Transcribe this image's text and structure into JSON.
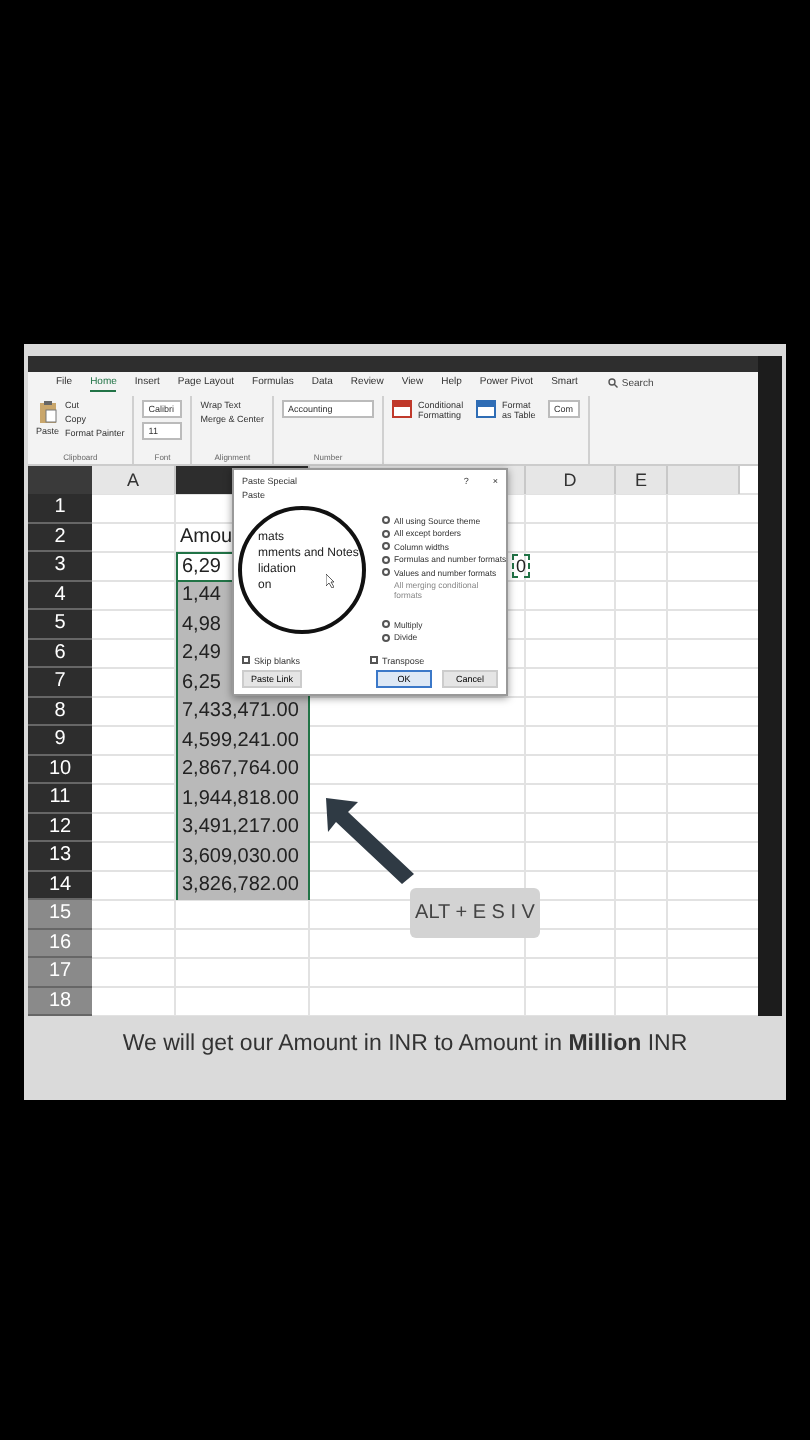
{
  "ribbon": {
    "tabs": [
      {
        "label": "File",
        "selected": false
      },
      {
        "label": "Home",
        "selected": true
      },
      {
        "label": "Insert",
        "selected": false
      },
      {
        "label": "Page Layout",
        "selected": false
      },
      {
        "label": "Formulas",
        "selected": false
      },
      {
        "label": "Data",
        "selected": false
      },
      {
        "label": "Review",
        "selected": false
      },
      {
        "label": "View",
        "selected": false
      },
      {
        "label": "Help",
        "selected": false
      },
      {
        "label": "Power Pivot",
        "selected": false
      },
      {
        "label": "Smart",
        "selected": false
      }
    ],
    "search": "Search",
    "groups": [
      {
        "label": "Clipboard",
        "big": "Paste",
        "items": [
          "Cut",
          "Copy",
          "Format Painter"
        ]
      },
      {
        "label": "Font",
        "items": [
          "Calibri",
          "11"
        ]
      },
      {
        "label": "Alignment",
        "items": [
          "Wrap Text",
          "Merge & Center"
        ]
      },
      {
        "label": "Number",
        "items": [
          "Accounting"
        ]
      },
      {
        "items": [
          "Conditional Formatting",
          "Format as Table",
          "Com"
        ]
      }
    ]
  },
  "sheet": {
    "columns": [
      {
        "label": "A",
        "selected": false
      },
      {
        "selected": true
      },
      {
        "selected": false
      },
      {
        "label": "D",
        "selected": false
      },
      {
        "label": "E",
        "selected": false
      },
      {
        "selected": false
      }
    ],
    "rows": [
      {
        "number": "1",
        "selected": true,
        "kind": "plain"
      },
      {
        "number": "2",
        "selected": true,
        "kind": "plain",
        "value": "Amou"
      },
      {
        "number": "3",
        "selected": true,
        "kind": "active",
        "value": "6,29",
        "copied_value": "0"
      },
      {
        "number": "4",
        "selected": true,
        "kind": "range",
        "value": "1,44"
      },
      {
        "number": "5",
        "selected": true,
        "kind": "range",
        "value": "4,98"
      },
      {
        "number": "6",
        "selected": true,
        "kind": "range",
        "value": "2,49"
      },
      {
        "number": "7",
        "selected": true,
        "kind": "range",
        "value": "6,25"
      },
      {
        "number": "8",
        "selected": true,
        "kind": "range",
        "value": "7,433,471.00"
      },
      {
        "number": "9",
        "selected": true,
        "kind": "range",
        "value": "4,599,241.00"
      },
      {
        "number": "10",
        "selected": true,
        "kind": "range",
        "value": "2,867,764.00"
      },
      {
        "number": "11",
        "selected": true,
        "kind": "range",
        "value": "1,944,818.00"
      },
      {
        "number": "12",
        "selected": true,
        "kind": "range",
        "value": "3,491,217.00"
      },
      {
        "number": "13",
        "selected": true,
        "kind": "range",
        "value": "3,609,030.00"
      },
      {
        "number": "14",
        "selected": true,
        "kind": "range",
        "value": "3,826,782.00"
      },
      {
        "number": "15",
        "selected": false,
        "kind": "plain"
      },
      {
        "number": "16",
        "selected": false,
        "kind": "plain"
      },
      {
        "number": "17",
        "selected": false,
        "kind": "plain"
      },
      {
        "number": "18",
        "selected": false,
        "kind": "plain"
      }
    ]
  },
  "dialog": {
    "title": "Paste Special",
    "help": "?",
    "close": "×",
    "section": "Paste",
    "options": [
      {
        "label": "All using Source theme",
        "selected": false
      },
      {
        "label": "All except borders",
        "selected": false
      },
      {
        "label": "Column widths",
        "selected": false
      },
      {
        "label": "Formulas and number formats",
        "selected": false
      },
      {
        "label": "Values and number formats",
        "selected": false
      }
    ],
    "note": "All merging conditional formats",
    "operations": [
      {
        "label": "Multiply",
        "selected": false
      },
      {
        "label": "Divide",
        "selected": false
      }
    ],
    "checks": [
      {
        "label": "Skip blanks",
        "checked": false
      },
      {
        "label": "Transpose",
        "checked": false
      }
    ],
    "buttons": [
      {
        "label": "Paste Link",
        "default": false
      },
      {
        "label": "OK",
        "default": true
      },
      {
        "label": "Cancel",
        "default": false
      }
    ],
    "magnifier": [
      "mats",
      "mments and Notes",
      "lidation",
      "on"
    ]
  },
  "shortcut": "ALT + E S I V",
  "caption": "We will get our Amount in INR to Amount in **Million** INR"
}
